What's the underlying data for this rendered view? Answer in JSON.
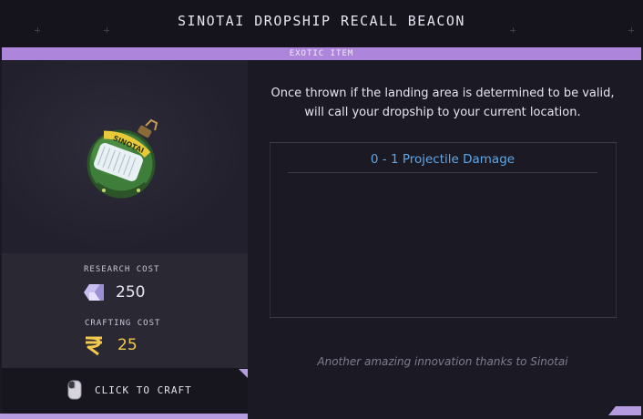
{
  "item": {
    "title": "SINOTAI DROPSHIP RECALL BEACON",
    "rarity": "EXOTIC ITEM",
    "description": "Once thrown if the landing area is determined to be valid, will call your dropship to your current location.",
    "stats": [
      "0 - 1 Projectile Damage"
    ],
    "flavor": "Another amazing innovation thanks to Sinotai",
    "image": {
      "icon": "beacon-grenade-icon",
      "brand_text": "SINOTAI"
    }
  },
  "costs": {
    "research_label": "RESEARCH COST",
    "research_value": "250",
    "research_icon": "research-crystal-icon",
    "crafting_label": "CRAFTING COST",
    "crafting_value": "25",
    "crafting_icon": "currency-rupee-icon"
  },
  "action": {
    "craft_label": "CLICK TO CRAFT",
    "icon": "mouse-left-click-icon"
  },
  "colors": {
    "rarity_bar": "#ad86db",
    "stat_text": "#5fa6e6",
    "crafting_value": "#f2c94c",
    "accent": "#c6b8e3"
  }
}
